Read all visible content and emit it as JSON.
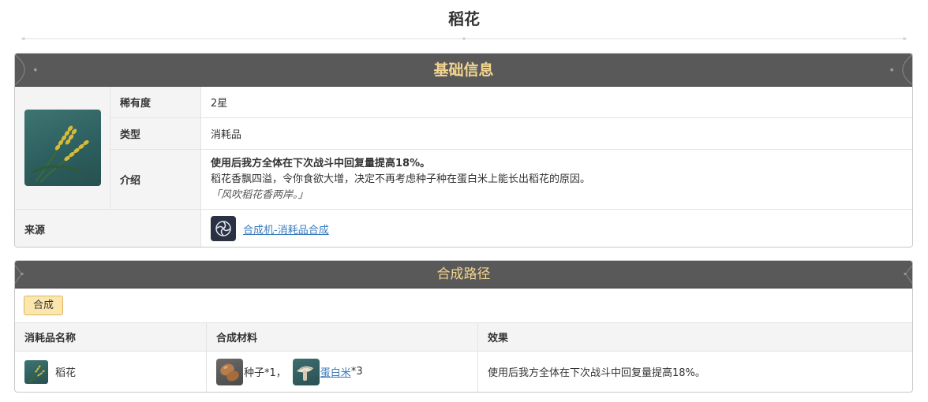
{
  "page": {
    "title": "稻花"
  },
  "info": {
    "header": "基础信息",
    "rows": [
      {
        "label": "稀有度",
        "value": "2星"
      },
      {
        "label": "类型",
        "value": "消耗品"
      }
    ],
    "description": {
      "label": "介绍",
      "effect": "使用后我方全体在下次战斗中回复量提高18%。",
      "flavor": "稻花香飘四溢，令你食欲大增，决定不再考虑种子种在蛋白米上能长出稻花的原因。",
      "quote": "「风吹稻花香两岸。」"
    },
    "source": {
      "label": "来源",
      "link_text": "合成机-消耗品合成",
      "icon": "synthesizer-icon"
    },
    "item_icon": "rice-flower-icon"
  },
  "crafting": {
    "header": "合成路径",
    "tab": "合成",
    "columns": [
      "消耗品名称",
      "合成材料",
      "效果"
    ],
    "rows": [
      {
        "name": "稻花",
        "materials": [
          {
            "name": "种子",
            "qty": "*1，",
            "link": false,
            "icon": "seed-icon"
          },
          {
            "name": "蛋白米",
            "qty": "*3",
            "link": true,
            "icon": "protein-rice-icon"
          }
        ],
        "effect": "使用后我方全体在下次战斗中回复量提高18%。"
      }
    ]
  },
  "colors": {
    "header_bg": "#595959",
    "header_text": "#f3d58f",
    "link": "#3a7bbf",
    "tab_bg": "#fbe7ae"
  }
}
